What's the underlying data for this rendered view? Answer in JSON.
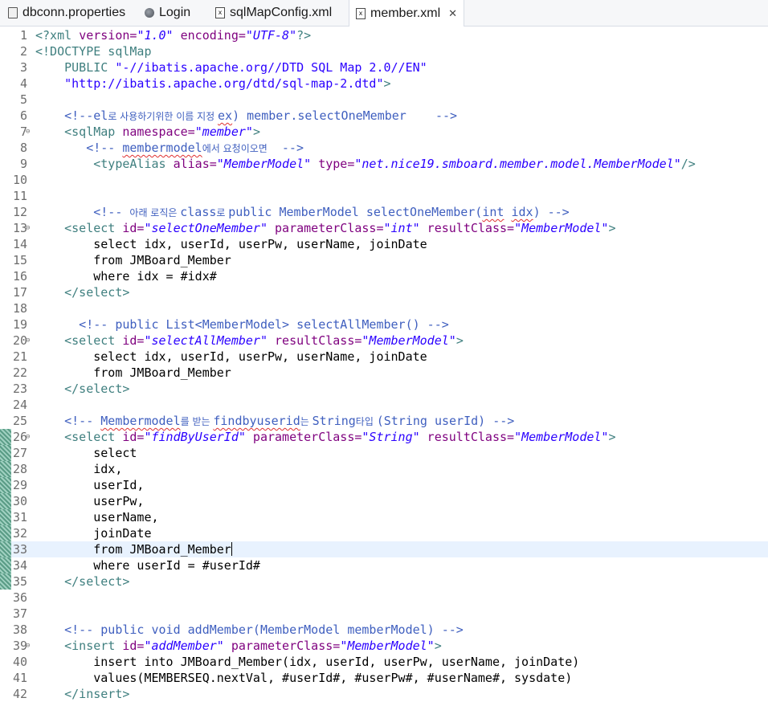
{
  "tabs": [
    {
      "label": "dbconn.properties",
      "icon": "properties-file-icon",
      "active": false
    },
    {
      "label": "Login",
      "icon": "globe-icon",
      "active": false
    },
    {
      "label": "sqlMapConfig.xml",
      "icon": "xml-file-icon",
      "active": false
    },
    {
      "label": "member.xml",
      "icon": "xml-file-icon",
      "active": true,
      "close": "✕"
    }
  ],
  "editor": {
    "current_line": 33,
    "changed_lines": [
      26,
      27,
      28,
      29,
      30,
      31,
      32,
      33,
      34,
      35
    ],
    "folds": [
      7,
      13,
      20,
      26,
      39
    ],
    "lines": [
      {
        "n": "1",
        "segs": [
          [
            "pi",
            "<?xml "
          ],
          [
            "attr",
            "version="
          ],
          [
            "val",
            "\"1.0\""
          ],
          [
            "attr",
            " encoding="
          ],
          [
            "val",
            "\"UTF-8\""
          ],
          [
            "pi",
            "?>"
          ]
        ]
      },
      {
        "n": "2",
        "segs": [
          [
            "doc",
            "<!DOCTYPE sqlMap"
          ]
        ]
      },
      {
        "n": "3",
        "segs": [
          [
            "doc",
            "    PUBLIC "
          ],
          [
            "str",
            "\"-//ibatis.apache.org//DTD SQL Map 2.0//EN\""
          ]
        ]
      },
      {
        "n": "4",
        "segs": [
          [
            "str",
            "    \"http://ibatis.apache.org/dtd/sql-map-2.dtd\""
          ],
          [
            "doc",
            ">"
          ]
        ]
      },
      {
        "n": "5",
        "segs": []
      },
      {
        "n": "6",
        "segs": [
          [
            "com",
            "    <!--el"
          ],
          [
            "comk",
            "로 사용하기위한 이름 지정 "
          ],
          [
            "comsq",
            "ex"
          ],
          [
            "com",
            ") member.selectOneMember    -->"
          ]
        ]
      },
      {
        "n": "7",
        "segs": [
          [
            "tag",
            "    <sqlMap "
          ],
          [
            "attr",
            "namespace="
          ],
          [
            "val",
            "\"member\""
          ],
          [
            "tag",
            ">"
          ]
        ]
      },
      {
        "n": "8",
        "segs": [
          [
            "com",
            "       <!-- "
          ],
          [
            "comsq",
            "membermodel"
          ],
          [
            "comk",
            "에서 요청이오면"
          ],
          [
            "com",
            "  -->"
          ]
        ]
      },
      {
        "n": "9",
        "segs": [
          [
            "tag",
            "        <typeAlias "
          ],
          [
            "attr",
            "alias="
          ],
          [
            "val",
            "\"MemberModel\""
          ],
          [
            "attr",
            " type="
          ],
          [
            "val",
            "\"net.nice19.smboard.member.model.MemberModel\""
          ],
          [
            "tag",
            "/>"
          ]
        ]
      },
      {
        "n": "10",
        "segs": []
      },
      {
        "n": "11",
        "segs": []
      },
      {
        "n": "12",
        "segs": [
          [
            "com",
            "        <!-- "
          ],
          [
            "comk",
            "아래 로직은 "
          ],
          [
            "com",
            "class"
          ],
          [
            "comk",
            "로 "
          ],
          [
            "com",
            "public MemberModel selectOneMember("
          ],
          [
            "comsq",
            "int"
          ],
          [
            "com",
            " "
          ],
          [
            "comsq",
            "idx"
          ],
          [
            "com",
            ") -->"
          ]
        ]
      },
      {
        "n": "13",
        "segs": [
          [
            "tag",
            "    <select "
          ],
          [
            "attr",
            "id="
          ],
          [
            "val",
            "\"selectOneMember\""
          ],
          [
            "attr",
            " parameterClass="
          ],
          [
            "val",
            "\"int\""
          ],
          [
            "attr",
            " resultClass="
          ],
          [
            "val",
            "\"MemberModel\""
          ],
          [
            "tag",
            ">"
          ]
        ]
      },
      {
        "n": "14",
        "segs": [
          [
            "txt",
            "        select idx, userId, userPw, userName, joinDate"
          ]
        ]
      },
      {
        "n": "15",
        "segs": [
          [
            "txt",
            "        from JMBoard_Member"
          ]
        ]
      },
      {
        "n": "16",
        "segs": [
          [
            "txt",
            "        where idx = #idx#"
          ]
        ]
      },
      {
        "n": "17",
        "segs": [
          [
            "tag",
            "    </select>"
          ]
        ]
      },
      {
        "n": "18",
        "segs": []
      },
      {
        "n": "19",
        "segs": [
          [
            "com",
            "      <!-- public List<MemberModel> selectAllMember() -->"
          ]
        ]
      },
      {
        "n": "20",
        "segs": [
          [
            "tag",
            "    <select "
          ],
          [
            "attr",
            "id="
          ],
          [
            "val",
            "\"selectAllMember\""
          ],
          [
            "attr",
            " resultClass="
          ],
          [
            "val",
            "\"MemberModel\""
          ],
          [
            "tag",
            ">"
          ]
        ]
      },
      {
        "n": "21",
        "segs": [
          [
            "txt",
            "        select idx, userId, userPw, userName, joinDate"
          ]
        ]
      },
      {
        "n": "22",
        "segs": [
          [
            "txt",
            "        from JMBoard_Member"
          ]
        ]
      },
      {
        "n": "23",
        "segs": [
          [
            "tag",
            "    </select>"
          ]
        ]
      },
      {
        "n": "24",
        "segs": []
      },
      {
        "n": "25",
        "segs": [
          [
            "com",
            "    <!-- "
          ],
          [
            "comsq",
            "Membermodel"
          ],
          [
            "comk",
            "를 받는 "
          ],
          [
            "comsq",
            "findbyuserid"
          ],
          [
            "comk",
            "는 "
          ],
          [
            "com",
            "String"
          ],
          [
            "comk",
            "타입 "
          ],
          [
            "com",
            "(String userId) -->"
          ]
        ]
      },
      {
        "n": "26",
        "segs": [
          [
            "tag",
            "    <select "
          ],
          [
            "attr",
            "id="
          ],
          [
            "val",
            "\"findByUserId\""
          ],
          [
            "attr",
            " parameterClass="
          ],
          [
            "val",
            "\"String\""
          ],
          [
            "attr",
            " resultClass="
          ],
          [
            "val",
            "\"MemberModel\""
          ],
          [
            "tag",
            ">"
          ]
        ]
      },
      {
        "n": "27",
        "segs": [
          [
            "txt",
            "        select"
          ]
        ]
      },
      {
        "n": "28",
        "segs": [
          [
            "txt",
            "        idx,"
          ]
        ]
      },
      {
        "n": "29",
        "segs": [
          [
            "txt",
            "        userId,"
          ]
        ]
      },
      {
        "n": "30",
        "segs": [
          [
            "txt",
            "        userPw,"
          ]
        ]
      },
      {
        "n": "31",
        "segs": [
          [
            "txt",
            "        userName,"
          ]
        ]
      },
      {
        "n": "32",
        "segs": [
          [
            "txt",
            "        joinDate"
          ]
        ]
      },
      {
        "n": "33",
        "segs": [
          [
            "txt",
            "        from JMBoard_Member"
          ]
        ]
      },
      {
        "n": "34",
        "segs": [
          [
            "txt",
            "        where userId = #userId#"
          ]
        ]
      },
      {
        "n": "35",
        "segs": [
          [
            "tag",
            "    </select>"
          ]
        ]
      },
      {
        "n": "36",
        "segs": []
      },
      {
        "n": "37",
        "segs": []
      },
      {
        "n": "38",
        "segs": [
          [
            "com",
            "    <!-- public void addMember(MemberModel memberModel) -->"
          ]
        ]
      },
      {
        "n": "39",
        "segs": [
          [
            "tag",
            "    <insert "
          ],
          [
            "attr",
            "id="
          ],
          [
            "val",
            "\"addMember\""
          ],
          [
            "attr",
            " parameterClass="
          ],
          [
            "val",
            "\"MemberModel\""
          ],
          [
            "tag",
            ">"
          ]
        ]
      },
      {
        "n": "40",
        "segs": [
          [
            "txt",
            "        insert into JMBoard_Member(idx, userId, userPw, userName, joinDate)"
          ]
        ]
      },
      {
        "n": "41",
        "segs": [
          [
            "txt",
            "        values(MEMBERSEQ.nextVal, #userId#, #userPw#, #userName#, sysdate)"
          ]
        ]
      },
      {
        "n": "42",
        "segs": [
          [
            "tag",
            "    </insert>"
          ]
        ]
      }
    ]
  }
}
